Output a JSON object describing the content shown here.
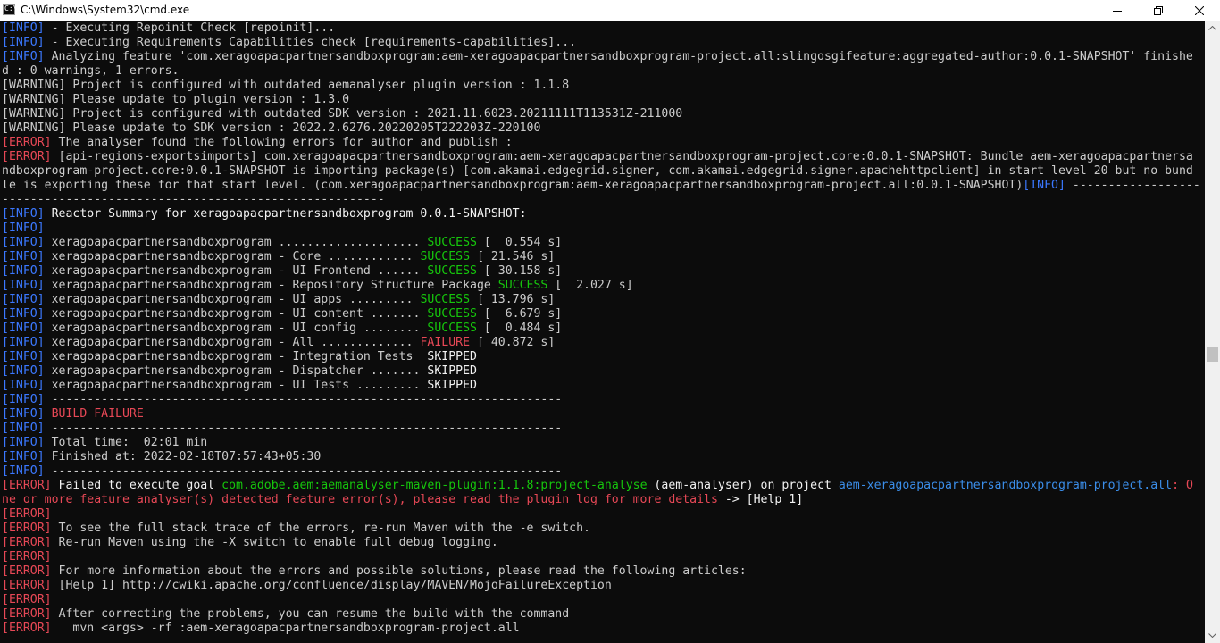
{
  "window": {
    "title": "C:\\Windows\\System32\\cmd.exe",
    "icon": "cmd-icon",
    "icon_text": "C:\\"
  },
  "controls": {
    "minimize": "minimize-icon",
    "maximize": "maximize-icon",
    "close": "close-icon"
  },
  "colors": {
    "background": "#0c0c0c",
    "text": "#cccccc",
    "info": "#3b78ff",
    "error": "#e74856",
    "success": "#16c60c"
  },
  "lines": [
    [
      [
        "info",
        "[INFO]"
      ],
      [
        "default",
        " - Executing Repoinit Check [repoinit]..."
      ]
    ],
    [
      [
        "info",
        "[INFO]"
      ],
      [
        "default",
        " - Executing Requirements Capabilities check [requirements-capabilities]..."
      ]
    ],
    [
      [
        "info",
        "[INFO]"
      ],
      [
        "default",
        " Analyzing feature 'com.xeragoapacpartnersandboxprogram:aem-xeragoapacpartnersandboxprogram-project.all:slingosgifeature:aggregated-author:0.0.1-SNAPSHOT' finishe"
      ]
    ],
    [
      [
        "default",
        "d : 0 warnings, 1 errors."
      ]
    ],
    [
      [
        "warn",
        "[WARNING]"
      ],
      [
        "default",
        " Project is configured with outdated aemanalyser plugin version : 1.1.8"
      ]
    ],
    [
      [
        "warn",
        "[WARNING]"
      ],
      [
        "default",
        " Please update to plugin version : 1.3.0"
      ]
    ],
    [
      [
        "warn",
        "[WARNING]"
      ],
      [
        "default",
        " Project is configured with outdated SDK version : 2021.11.6023.20211111T113531Z-211000"
      ]
    ],
    [
      [
        "warn",
        "[WARNING]"
      ],
      [
        "default",
        " Please update to SDK version : 2022.2.6276.20220205T222203Z-220100"
      ]
    ],
    [
      [
        "error",
        "[ERROR]"
      ],
      [
        "default",
        " The analyser found the following errors for author and publish :"
      ]
    ],
    [
      [
        "error",
        "[ERROR]"
      ],
      [
        "default",
        " [api-regions-exportsimports] com.xeragoapacpartnersandboxprogram:aem-xeragoapacpartnersandboxprogram-project.core:0.0.1-SNAPSHOT: Bundle aem-xeragoapacpartnersa"
      ]
    ],
    [
      [
        "default",
        "ndboxprogram-project.core:0.0.1-SNAPSHOT is importing package(s) [com.akamai.edgegrid.signer, com.akamai.edgegrid.signer.apachehttpclient] in start level 20 but no bund"
      ]
    ],
    [
      [
        "default",
        "le is exporting these for that start level. (com.xeragoapacpartnersandboxprogram:aem-xeragoapacpartnersandboxprogram-project.all:0.0.1-SNAPSHOT)"
      ],
      [
        "info",
        "[INFO]"
      ],
      [
        "default",
        " ------------------"
      ]
    ],
    [
      [
        "default",
        "------------------------------------------------------"
      ]
    ],
    [
      [
        "info",
        "[INFO]"
      ],
      [
        "white",
        " Reactor Summary for xeragoapacpartnersandboxprogram 0.0.1-SNAPSHOT:"
      ]
    ],
    [
      [
        "info",
        "[INFO]"
      ]
    ],
    [
      [
        "info",
        "[INFO]"
      ],
      [
        "default",
        " xeragoapacpartnersandboxprogram .................... "
      ],
      [
        "green",
        "SUCCESS"
      ],
      [
        "default",
        " [  0.554 s]"
      ]
    ],
    [
      [
        "info",
        "[INFO]"
      ],
      [
        "default",
        " xeragoapacpartnersandboxprogram - Core ............ "
      ],
      [
        "green",
        "SUCCESS"
      ],
      [
        "default",
        " [ 21.546 s]"
      ]
    ],
    [
      [
        "info",
        "[INFO]"
      ],
      [
        "default",
        " xeragoapacpartnersandboxprogram - UI Frontend ...... "
      ],
      [
        "green",
        "SUCCESS"
      ],
      [
        "default",
        " [ 30.158 s]"
      ]
    ],
    [
      [
        "info",
        "[INFO]"
      ],
      [
        "default",
        " xeragoapacpartnersandboxprogram - Repository Structure Package "
      ],
      [
        "green",
        "SUCCESS"
      ],
      [
        "default",
        " [  2.027 s]"
      ]
    ],
    [
      [
        "info",
        "[INFO]"
      ],
      [
        "default",
        " xeragoapacpartnersandboxprogram - UI apps ......... "
      ],
      [
        "green",
        "SUCCESS"
      ],
      [
        "default",
        " [ 13.796 s]"
      ]
    ],
    [
      [
        "info",
        "[INFO]"
      ],
      [
        "default",
        " xeragoapacpartnersandboxprogram - UI content ....... "
      ],
      [
        "green",
        "SUCCESS"
      ],
      [
        "default",
        " [  6.679 s]"
      ]
    ],
    [
      [
        "info",
        "[INFO]"
      ],
      [
        "default",
        " xeragoapacpartnersandboxprogram - UI config ........ "
      ],
      [
        "green",
        "SUCCESS"
      ],
      [
        "default",
        " [  0.484 s]"
      ]
    ],
    [
      [
        "info",
        "[INFO]"
      ],
      [
        "default",
        " xeragoapacpartnersandboxprogram - All ............. "
      ],
      [
        "red",
        "FAILURE"
      ],
      [
        "default",
        " [ 40.872 s]"
      ]
    ],
    [
      [
        "info",
        "[INFO]"
      ],
      [
        "default",
        " xeragoapacpartnersandboxprogram - Integration Tests  "
      ],
      [
        "white",
        "SKIPPED"
      ]
    ],
    [
      [
        "info",
        "[INFO]"
      ],
      [
        "default",
        " xeragoapacpartnersandboxprogram - Dispatcher ....... "
      ],
      [
        "white",
        "SKIPPED"
      ]
    ],
    [
      [
        "info",
        "[INFO]"
      ],
      [
        "default",
        " xeragoapacpartnersandboxprogram - UI Tests ......... "
      ],
      [
        "white",
        "SKIPPED"
      ]
    ],
    [
      [
        "info",
        "[INFO]"
      ],
      [
        "default",
        " ------------------------------------------------------------------------"
      ]
    ],
    [
      [
        "info",
        "[INFO]"
      ],
      [
        "red",
        " BUILD FAILURE"
      ]
    ],
    [
      [
        "info",
        "[INFO]"
      ],
      [
        "default",
        " ------------------------------------------------------------------------"
      ]
    ],
    [
      [
        "info",
        "[INFO]"
      ],
      [
        "default",
        " Total time:  02:01 min"
      ]
    ],
    [
      [
        "info",
        "[INFO]"
      ],
      [
        "default",
        " Finished at: 2022-02-18T07:57:43+05:30"
      ]
    ],
    [
      [
        "info",
        "[INFO]"
      ],
      [
        "default",
        " ------------------------------------------------------------------------"
      ]
    ],
    [
      [
        "error",
        "[ERROR]"
      ],
      [
        "white",
        " Failed to execute goal "
      ],
      [
        "green",
        "com.adobe.aem:aemanalyser-maven-plugin:1.1.8:project-analyse"
      ],
      [
        "white",
        " (aem-analyser) on project "
      ],
      [
        "cyan",
        "aem-xeragoapacpartnersandboxprogram-project.all"
      ],
      [
        "red",
        ": O"
      ]
    ],
    [
      [
        "red",
        "ne or more feature analyser(s) detected feature error(s), please read the plugin log for more details"
      ],
      [
        "white",
        " -> [Help 1]"
      ]
    ],
    [
      [
        "error",
        "[ERROR]"
      ]
    ],
    [
      [
        "error",
        "[ERROR]"
      ],
      [
        "default",
        " To see the full stack trace of the errors, re-run Maven with the -e switch."
      ]
    ],
    [
      [
        "error",
        "[ERROR]"
      ],
      [
        "default",
        " Re-run Maven using the -X switch to enable full debug logging."
      ]
    ],
    [
      [
        "error",
        "[ERROR]"
      ]
    ],
    [
      [
        "error",
        "[ERROR]"
      ],
      [
        "default",
        " For more information about the errors and possible solutions, please read the following articles:"
      ]
    ],
    [
      [
        "error",
        "[ERROR]"
      ],
      [
        "default",
        " [Help 1] http://cwiki.apache.org/confluence/display/MAVEN/MojoFailureException"
      ]
    ],
    [
      [
        "error",
        "[ERROR]"
      ]
    ],
    [
      [
        "error",
        "[ERROR]"
      ],
      [
        "default",
        " After correcting the problems, you can resume the build with the command"
      ]
    ],
    [
      [
        "error",
        "[ERROR]"
      ],
      [
        "default",
        "   mvn <args> -rf :aem-xeragoapacpartnersandboxprogram-project.all"
      ]
    ]
  ]
}
